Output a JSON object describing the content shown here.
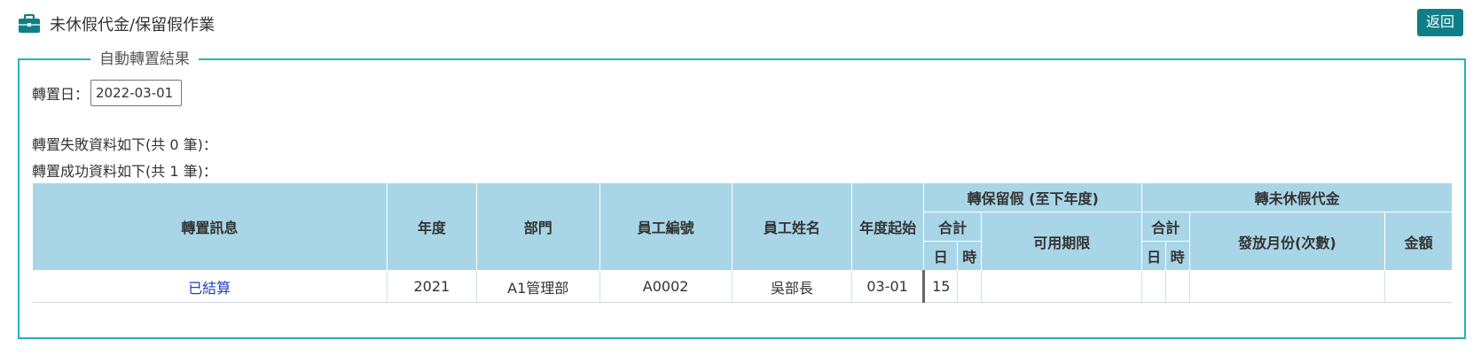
{
  "header": {
    "title": "未休假代金/保留假作業",
    "back_label": "返回",
    "icon": "briefcase-icon"
  },
  "section": {
    "legend": "自動轉置結果",
    "date_label": "轉置日：",
    "date_value": "2022-03-01",
    "fail_text": "轉置失敗資料如下(共 0 筆)：",
    "success_text": "轉置成功資料如下(共 1 筆)："
  },
  "table": {
    "headers": {
      "message": "轉置訊息",
      "year": "年度",
      "dept": "部門",
      "emp_id": "員工編號",
      "emp_name": "員工姓名",
      "year_start": "年度起始",
      "retain_group": "轉保留假 (至下年度)",
      "retain_total": "合計",
      "retain_day": "日",
      "retain_hour": "時",
      "retain_deadline": "可用期限",
      "cash_group": "轉未休假代金",
      "cash_total": "合計",
      "cash_day": "日",
      "cash_hour": "時",
      "cash_month": "發放月份(次數)",
      "cash_amount": "金額"
    },
    "rows": [
      {
        "message": "已結算",
        "year": "2021",
        "dept": "A1管理部",
        "emp_id": "A0002",
        "emp_name": "吳部長",
        "year_start": "03-01",
        "retain_day": "15",
        "retain_hour": "",
        "retain_deadline": "",
        "cash_day": "",
        "cash_hour": "",
        "cash_month": "",
        "cash_amount": ""
      }
    ]
  },
  "colors": {
    "accent": "#0e7f86",
    "panel_border": "#28b1b7",
    "header_bg": "#a9d6e6",
    "link": "#1f3dbf"
  }
}
